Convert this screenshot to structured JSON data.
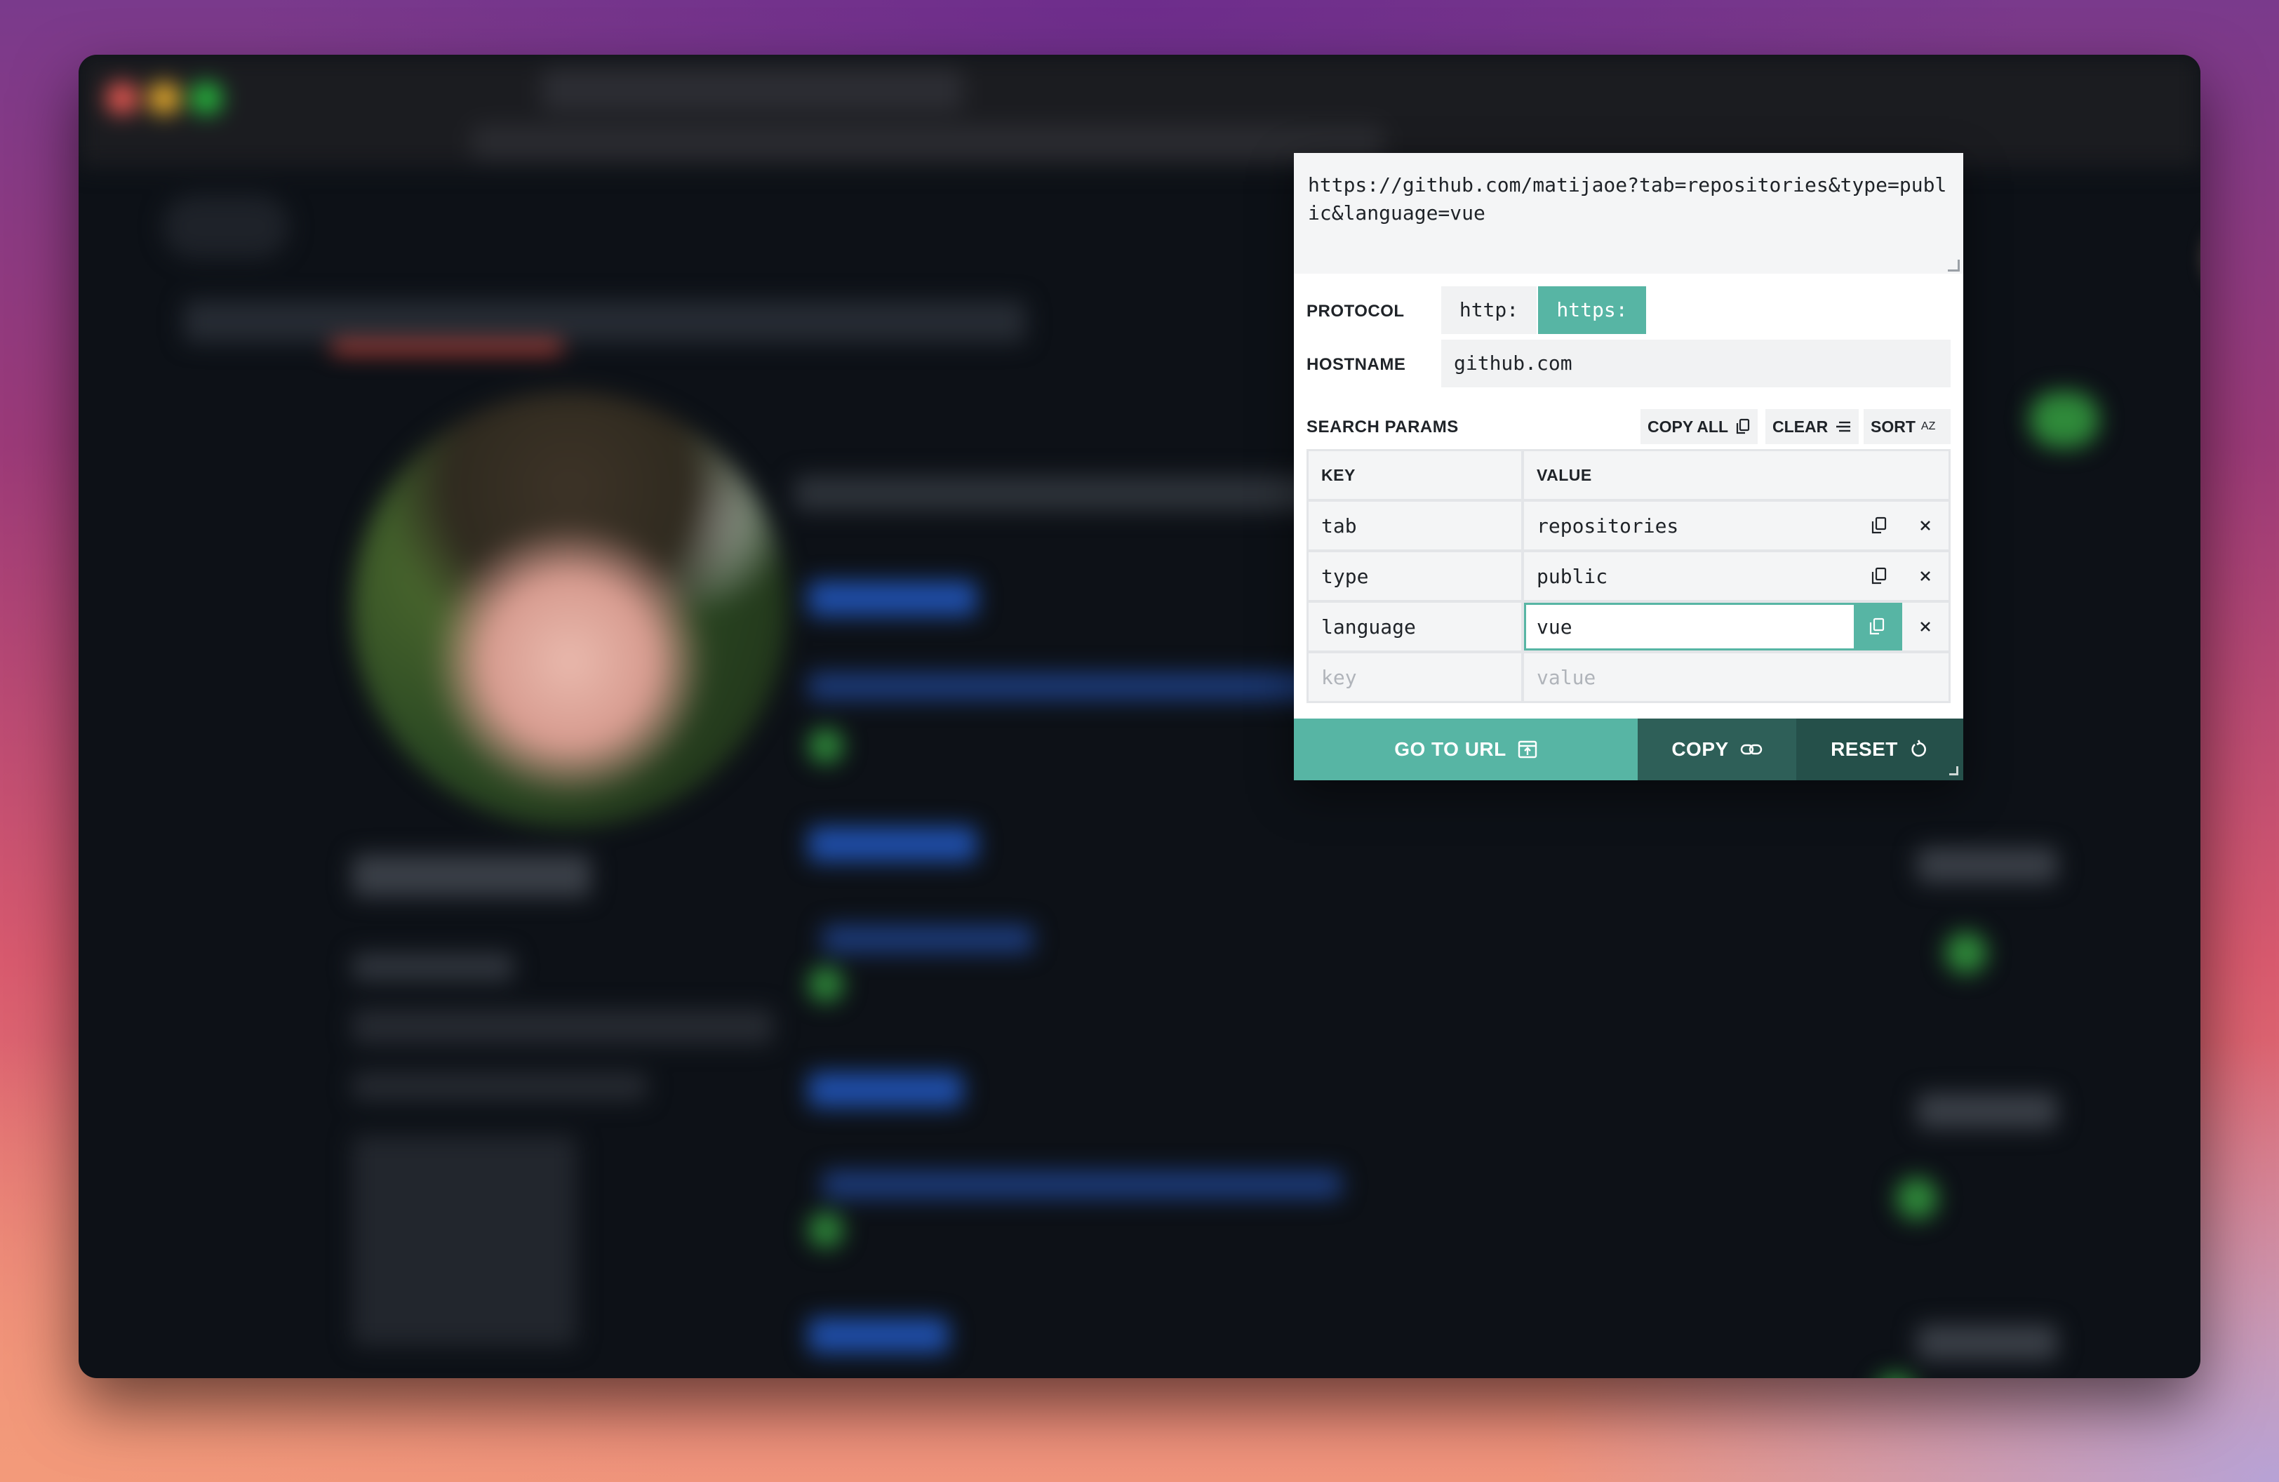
{
  "popup": {
    "url_text": "https://github.com/matijaoe?tab=repositories&type=public&language=vue",
    "protocol": {
      "label": "PROTOCOL",
      "options": [
        "http:",
        "https:"
      ],
      "selected": "https:"
    },
    "hostname": {
      "label": "HOSTNAME",
      "value": "github.com"
    },
    "search_params": {
      "label": "SEARCH PARAMS",
      "copy_all_label": "COPY ALL",
      "clear_label": "CLEAR",
      "sort_label": "SORT",
      "sort_icon_text": "AZ",
      "columns": [
        "KEY",
        "VALUE"
      ],
      "rows": [
        {
          "key": "tab",
          "value": "repositories"
        },
        {
          "key": "type",
          "value": "public"
        },
        {
          "key": "language",
          "value": "vue"
        }
      ],
      "new_row": {
        "key_placeholder": "key",
        "value_placeholder": "value"
      }
    },
    "actions": {
      "go_to_url_label": "GO TO URL",
      "copy_label": "COPY",
      "reset_label": "RESET"
    }
  },
  "colors": {
    "accent": "#57b5a4",
    "dark_accent": "#2e5f58",
    "darker_accent": "#25504a"
  }
}
